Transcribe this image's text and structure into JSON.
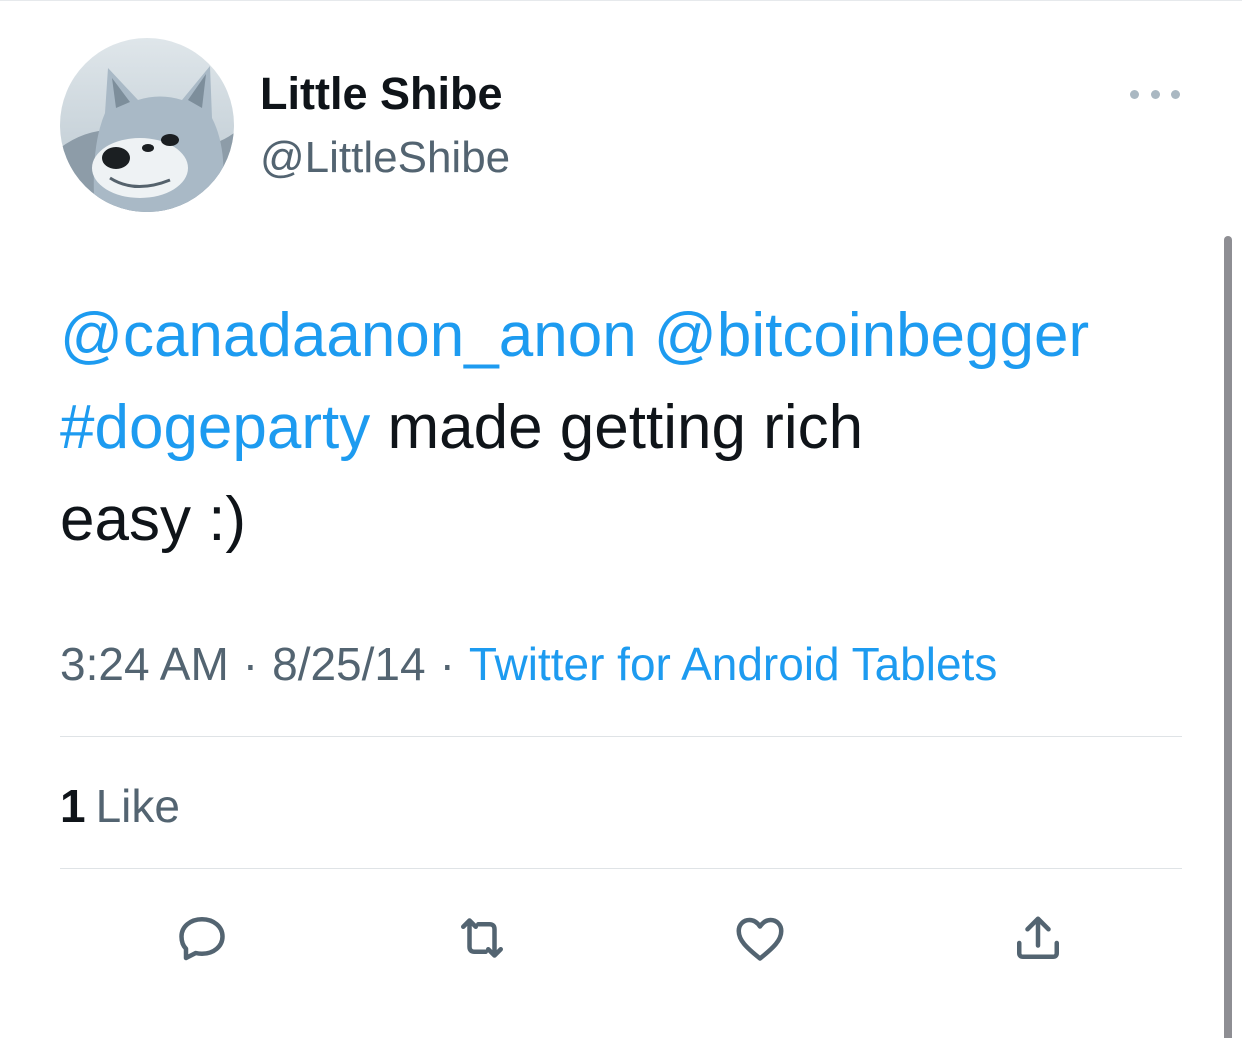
{
  "author": {
    "display_name": "Little Shibe",
    "handle": "@LittleShibe",
    "avatar_icon": "shiba-dog-avatar"
  },
  "more_icon": "more-horizontal-icon",
  "tweet": {
    "mention_1": "@canadaanon_anon",
    "mention_2": "@bitcoinbegger",
    "hashtag": "#dogeparty",
    "text_part_1": "made getting rich",
    "text_part_2": "easy :)"
  },
  "meta": {
    "time": "3:24 AM",
    "separator": "·",
    "date": "8/25/14",
    "source": "Twitter for Android Tablets"
  },
  "stats": {
    "likes_count": "1",
    "likes_label": "Like"
  },
  "actions": [
    {
      "icon": "reply-icon"
    },
    {
      "icon": "retweet-icon"
    },
    {
      "icon": "like-icon"
    },
    {
      "icon": "share-icon"
    }
  ],
  "colors": {
    "link": "#1d9bf0",
    "text": "#0f1419",
    "secondary": "#536471",
    "divider": "#dfe3e6"
  }
}
